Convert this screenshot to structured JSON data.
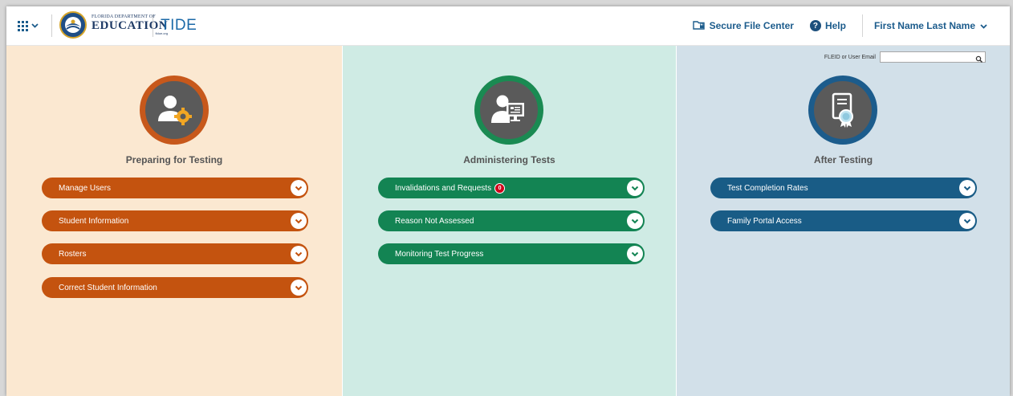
{
  "header": {
    "logo": {
      "line1": "FLORIDA DEPARTMENT OF",
      "line2": "EDUCATION",
      "line3": "fldoe.org"
    },
    "app_name": "TIDE",
    "secure_file_center": "Secure File Center",
    "help": "Help",
    "user_name": "First Name Last Name"
  },
  "panels": [
    {
      "title": "Preparing for Testing",
      "icon": "user-gear-icon",
      "color": "#c4530f",
      "items": [
        {
          "label": "Manage Users"
        },
        {
          "label": "Student Information"
        },
        {
          "label": "Rosters"
        },
        {
          "label": "Correct Student Information"
        }
      ]
    },
    {
      "title": "Administering Tests",
      "icon": "user-monitor-icon",
      "color": "#138453",
      "items": [
        {
          "label": "Invalidations and Requests",
          "badge": "0"
        },
        {
          "label": "Reason Not Assessed"
        },
        {
          "label": "Monitoring Test Progress"
        }
      ]
    },
    {
      "title": "After Testing",
      "icon": "certificate-icon",
      "color": "#195c86",
      "items": [
        {
          "label": "Test Completion Rates"
        },
        {
          "label": "Family Portal Access"
        }
      ]
    }
  ],
  "search": {
    "label": "FLEID or User Email",
    "value": ""
  },
  "colors": {
    "panel1_bg": "#fbe8d1",
    "panel2_bg": "#cfebe4",
    "panel3_bg": "#d2e0e9"
  }
}
